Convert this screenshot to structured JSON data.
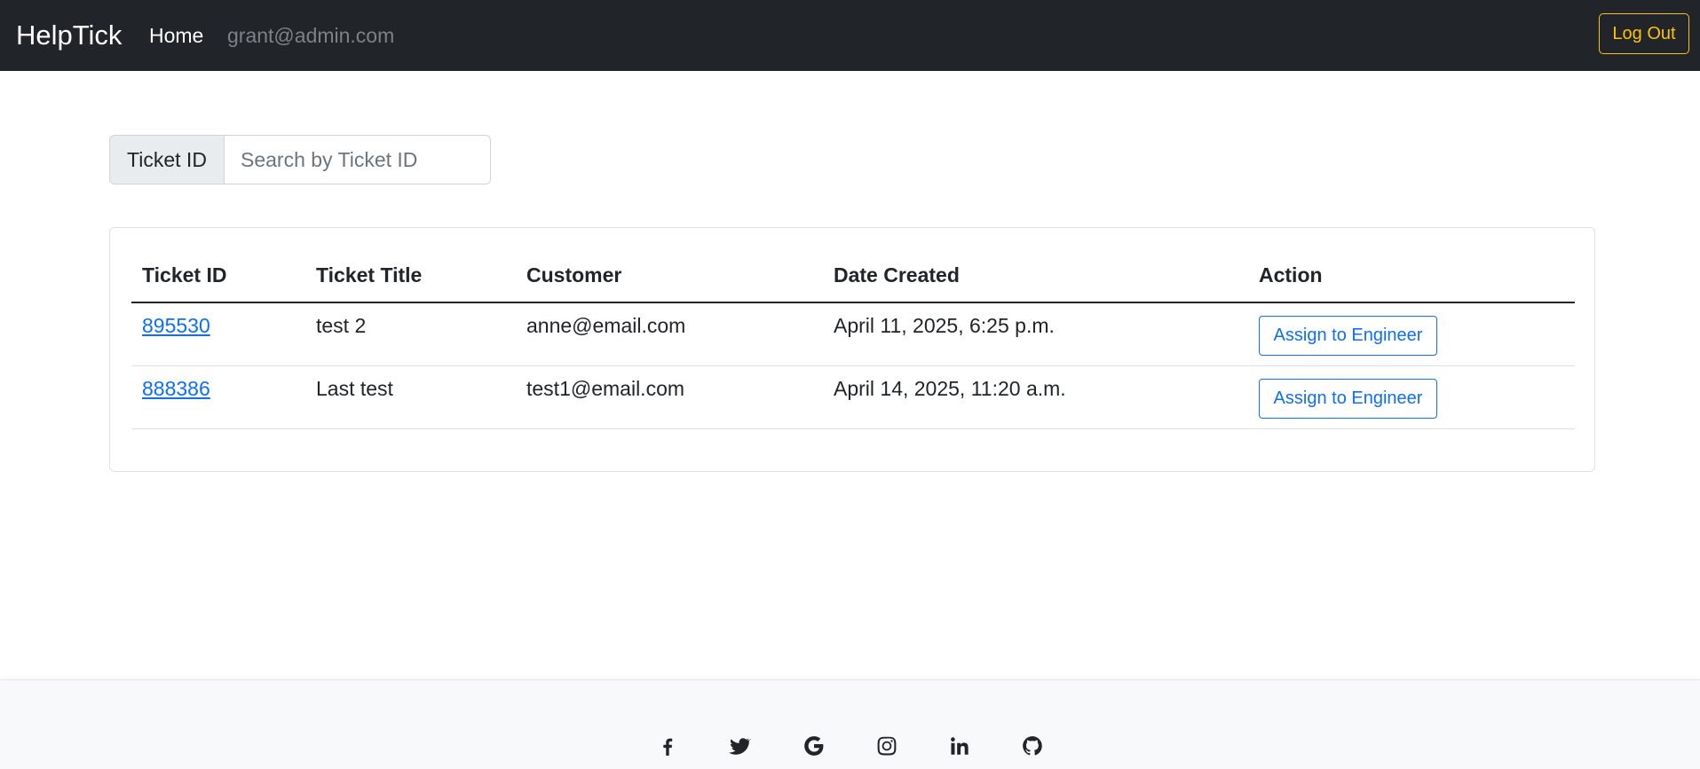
{
  "navbar": {
    "brand": "HelpTick",
    "home_label": "Home",
    "user_email": "grant@admin.com",
    "logout_label": "Log Out"
  },
  "search": {
    "addon_label": "Ticket ID",
    "placeholder": "Search by Ticket ID",
    "value": ""
  },
  "table": {
    "headers": [
      "Ticket ID",
      "Ticket Title",
      "Customer",
      "Date Created",
      "Action"
    ],
    "rows": [
      {
        "id": "895530",
        "title": "test 2",
        "customer": "anne@email.com",
        "date": "April 11, 2025, 6:25 p.m.",
        "action": "Assign to Engineer"
      },
      {
        "id": "888386",
        "title": "Last test",
        "customer": "test1@email.com",
        "date": "April 14, 2025, 11:20 a.m.",
        "action": "Assign to Engineer"
      }
    ]
  },
  "footer": {
    "socials": [
      "facebook-icon",
      "twitter-icon",
      "google-icon",
      "instagram-icon",
      "linkedin-icon",
      "github-icon"
    ]
  },
  "colors": {
    "navbar_bg": "#212529",
    "logout_accent": "#ffc107",
    "link_primary": "#0d6efd",
    "footer_bg": "#f8f9fa"
  }
}
